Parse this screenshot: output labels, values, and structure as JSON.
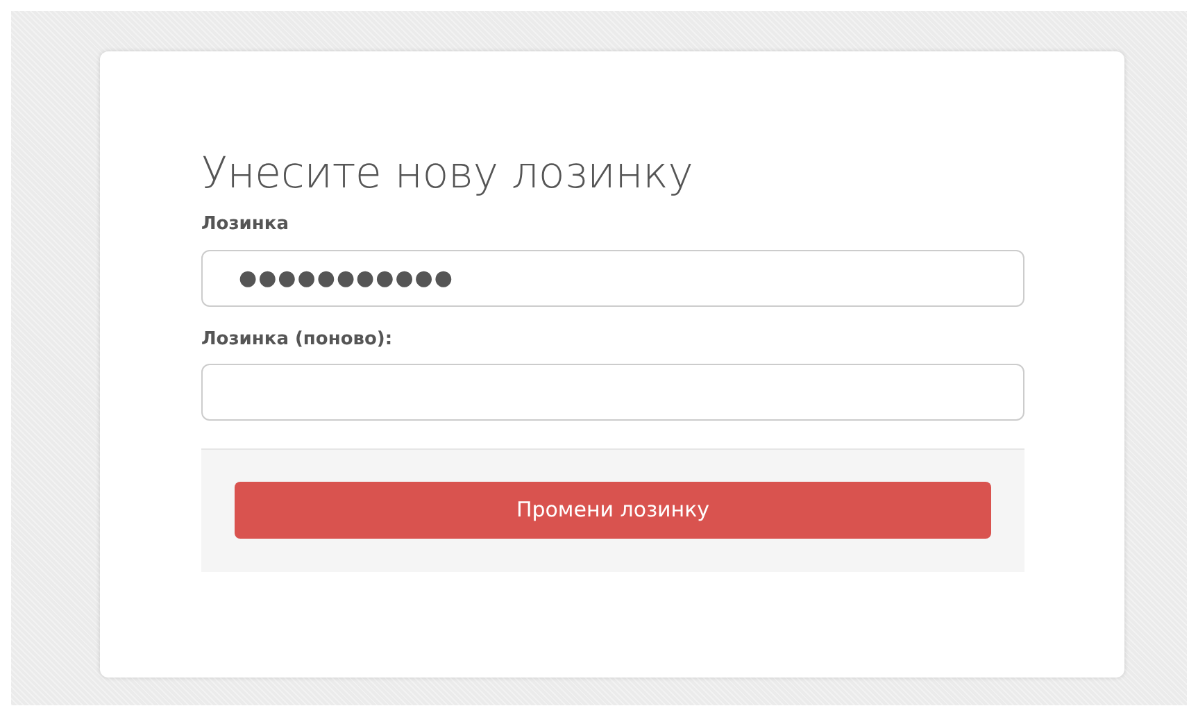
{
  "title": "Унесите нову лозинку",
  "fields": [
    {
      "label": "Лозинка",
      "value": "●●●●●●●●●●●"
    },
    {
      "label": "Лозинка (поново):"
    }
  ],
  "button": "Промени лозинку"
}
